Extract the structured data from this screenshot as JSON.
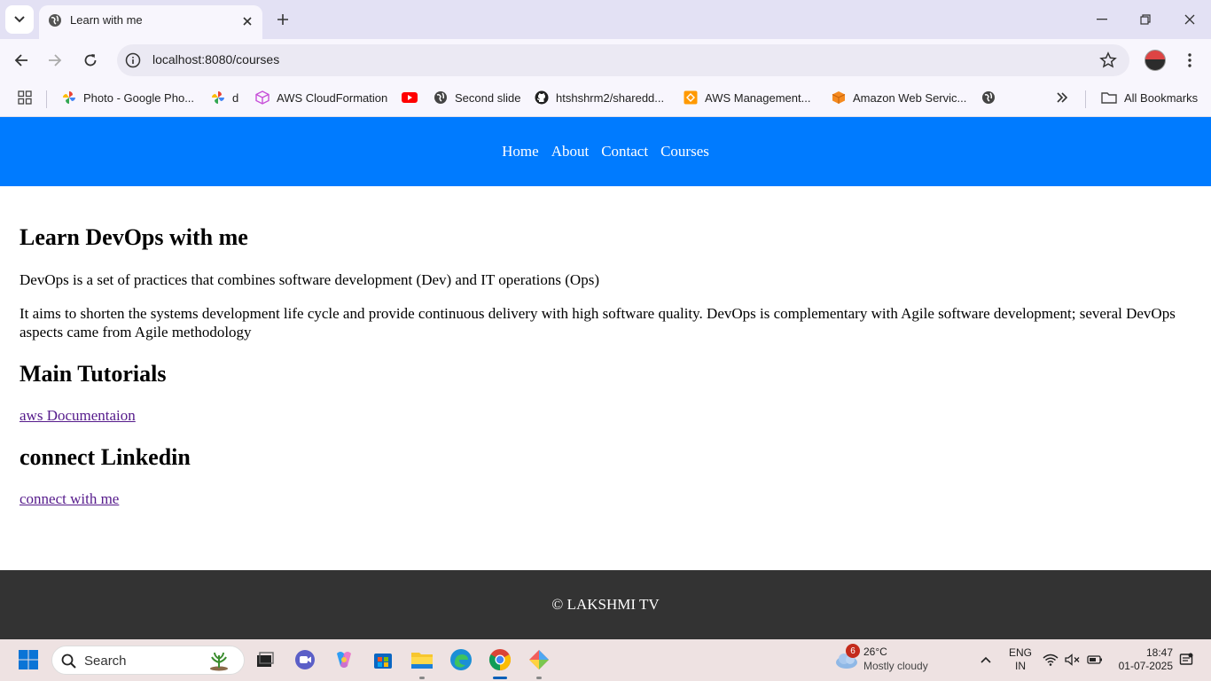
{
  "browser": {
    "tab_title": "Learn with me",
    "url": "localhost:8080/courses",
    "bookmarks": [
      {
        "label": "Photo - Google Pho...",
        "icon": "google-photos-icon"
      },
      {
        "label": "d",
        "icon": "google-photos-icon"
      },
      {
        "label": "AWS CloudFormation",
        "icon": "cube-icon"
      },
      {
        "label": "",
        "icon": "youtube-icon"
      },
      {
        "label": "Second slide",
        "icon": "globe-icon"
      },
      {
        "label": "htshshrm2/sharedd...",
        "icon": "github-icon"
      },
      {
        "label": "AWS Management...",
        "icon": "aws-icon"
      },
      {
        "label": "Amazon Web Servic...",
        "icon": "aws-box-icon"
      },
      {
        "label": "",
        "icon": "globe-icon"
      }
    ],
    "all_bookmarks": "All Bookmarks"
  },
  "site": {
    "nav": [
      "Home",
      "About",
      "Contact",
      "Courses"
    ],
    "heading1": "Learn DevOps with me",
    "para1": "DevOps is a set of practices that combines software development (Dev) and IT operations (Ops)",
    "para2": "It aims to shorten the systems development life cycle and provide continuous delivery with high software quality. DevOps is complementary with Agile software development; several DevOps aspects came from Agile methodology",
    "heading2": "Main Tutorials",
    "link1": "aws Documentaion",
    "heading3": "connect Linkedin",
    "link2": "connect with me",
    "footer": "© LAKSHMI TV"
  },
  "taskbar": {
    "search_placeholder": "Search",
    "weather_badge": "6",
    "temperature": "26°C",
    "condition": "Mostly cloudy",
    "lang_line1": "ENG",
    "lang_line2": "IN",
    "time": "18:47",
    "date": "01-07-2025"
  },
  "colors": {
    "nav_bg": "#007bff",
    "footer_bg": "#333333",
    "link": "#551a8b"
  }
}
